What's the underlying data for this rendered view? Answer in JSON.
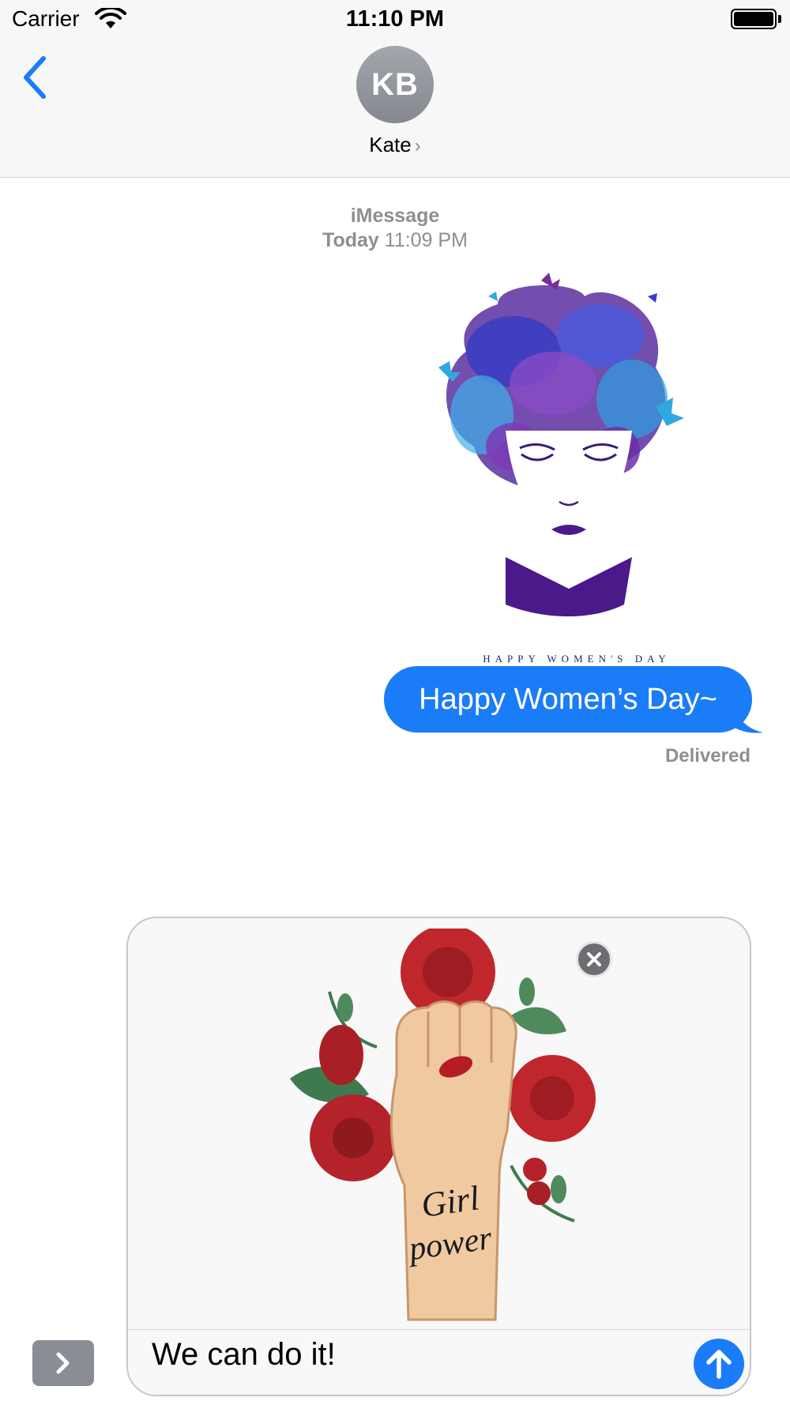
{
  "status_bar": {
    "carrier": "Carrier",
    "time": "11:10 PM",
    "wifi_icon": "wifi-icon",
    "battery_icon": "battery-icon"
  },
  "header": {
    "back_icon": "chevron-left-icon",
    "avatar_initials": "KB",
    "contact_name": "Kate",
    "contact_chevron": "›"
  },
  "conversation": {
    "service": "iMessage",
    "timestamp_day": "Today",
    "timestamp_time": "11:09 PM",
    "sticker_caption": "HAPPY WOMEN'S DAY",
    "message_text": "Happy Women’s Day~",
    "delivery_status": "Delivered"
  },
  "compose": {
    "input_value": "We can do it!",
    "sticker_text_line1": "Girl",
    "sticker_text_line2": "power",
    "close_icon": "close-icon",
    "send_icon": "arrow-up-icon",
    "apps_icon": "chevron-right-icon"
  },
  "colors": {
    "accent": "#1a7cf7",
    "secondary_text": "#8e8e93",
    "nav_background": "#f7f7f7"
  }
}
